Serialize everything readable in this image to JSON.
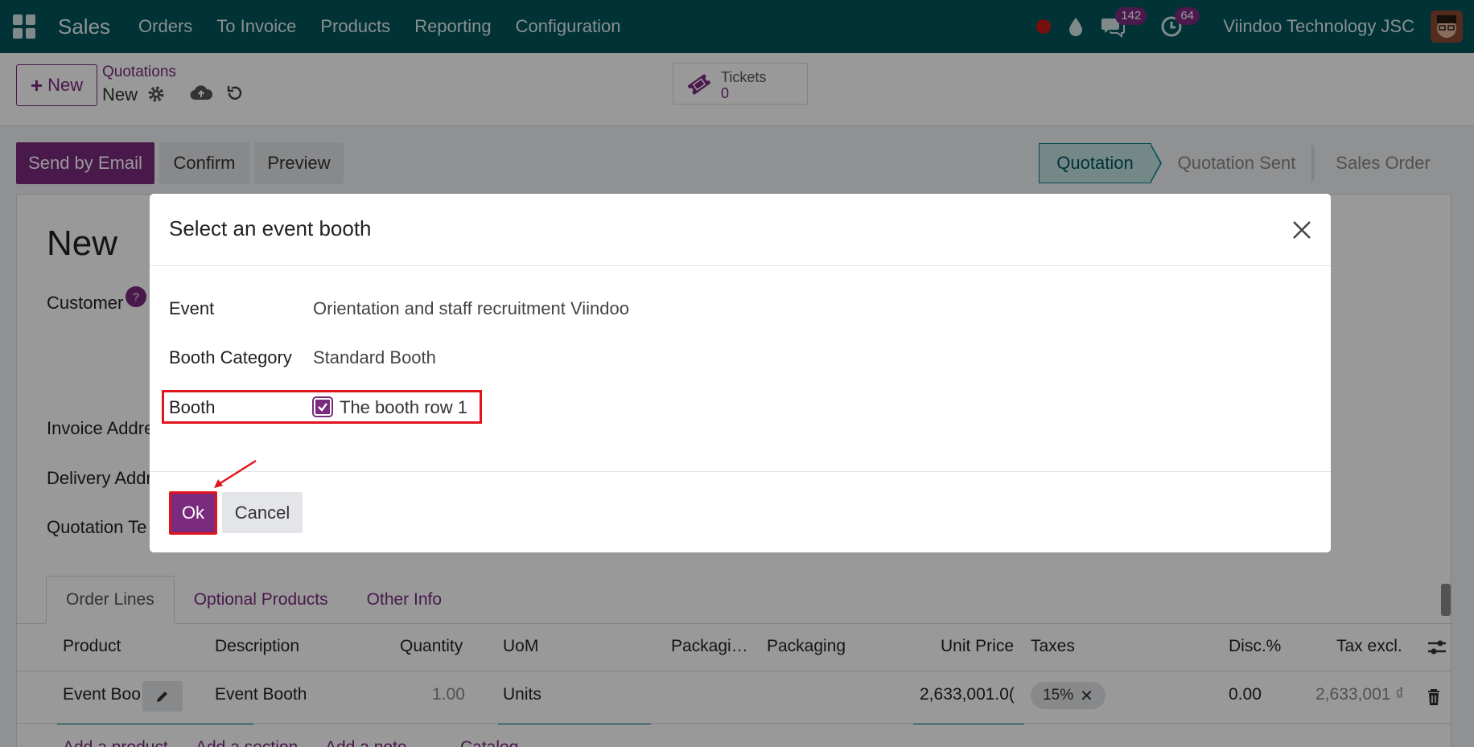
{
  "navbar": {
    "app_name": "Sales",
    "menu": [
      "Orders",
      "To Invoice",
      "Products",
      "Reporting",
      "Configuration"
    ],
    "messages_count": "142",
    "activities_count": "64",
    "company": "Viindoo Technology JSC"
  },
  "control_panel": {
    "new_label": "New",
    "breadcrumb_parent": "Quotations",
    "breadcrumb_current": "New",
    "tickets_label": "Tickets",
    "tickets_value": "0"
  },
  "statusbar": {
    "send_email_label": "Send by Email",
    "confirm_label": "Confirm",
    "preview_label": "Preview",
    "stages": [
      "Quotation",
      "Quotation Sent",
      "Sales Order"
    ],
    "active_stage": "Quotation"
  },
  "form": {
    "title": "New",
    "labels": {
      "customer": "Customer",
      "help_mark": "?",
      "invoice_address": "Invoice Addre",
      "delivery_address": "Delivery Addr",
      "quotation_template": "Quotation Te"
    },
    "tabs": [
      "Order Lines",
      "Optional Products",
      "Other Info"
    ],
    "columns": [
      "Product",
      "Description",
      "Quantity",
      "UoM",
      "Packagi…",
      "Packaging",
      "Unit Price",
      "Taxes",
      "Disc.%",
      "Tax excl."
    ],
    "row": {
      "product": "Event Boo",
      "description": "Event Booth",
      "quantity": "1.00",
      "uom": "Units",
      "unit_price": "2,633,001.0(",
      "tax": "15%",
      "discount": "0.00",
      "subtotal": "2,633,001 ₫"
    },
    "add_links": [
      "Add a product",
      "Add a section",
      "Add a note",
      "Catalog"
    ]
  },
  "dialog": {
    "title": "Select an event booth",
    "event_label": "Event",
    "event_value": "Orientation and staff recruitment Viindoo",
    "category_label": "Booth Category",
    "category_value": "Standard Booth",
    "booth_label": "Booth",
    "booth_option": "The booth row 1",
    "booth_checked": true,
    "ok_label": "Ok",
    "cancel_label": "Cancel"
  },
  "colors": {
    "navbar": "#00545b",
    "primary": "#7b2b7d",
    "highlight": "#e0141c",
    "stage_active": "#c4e3e3"
  }
}
